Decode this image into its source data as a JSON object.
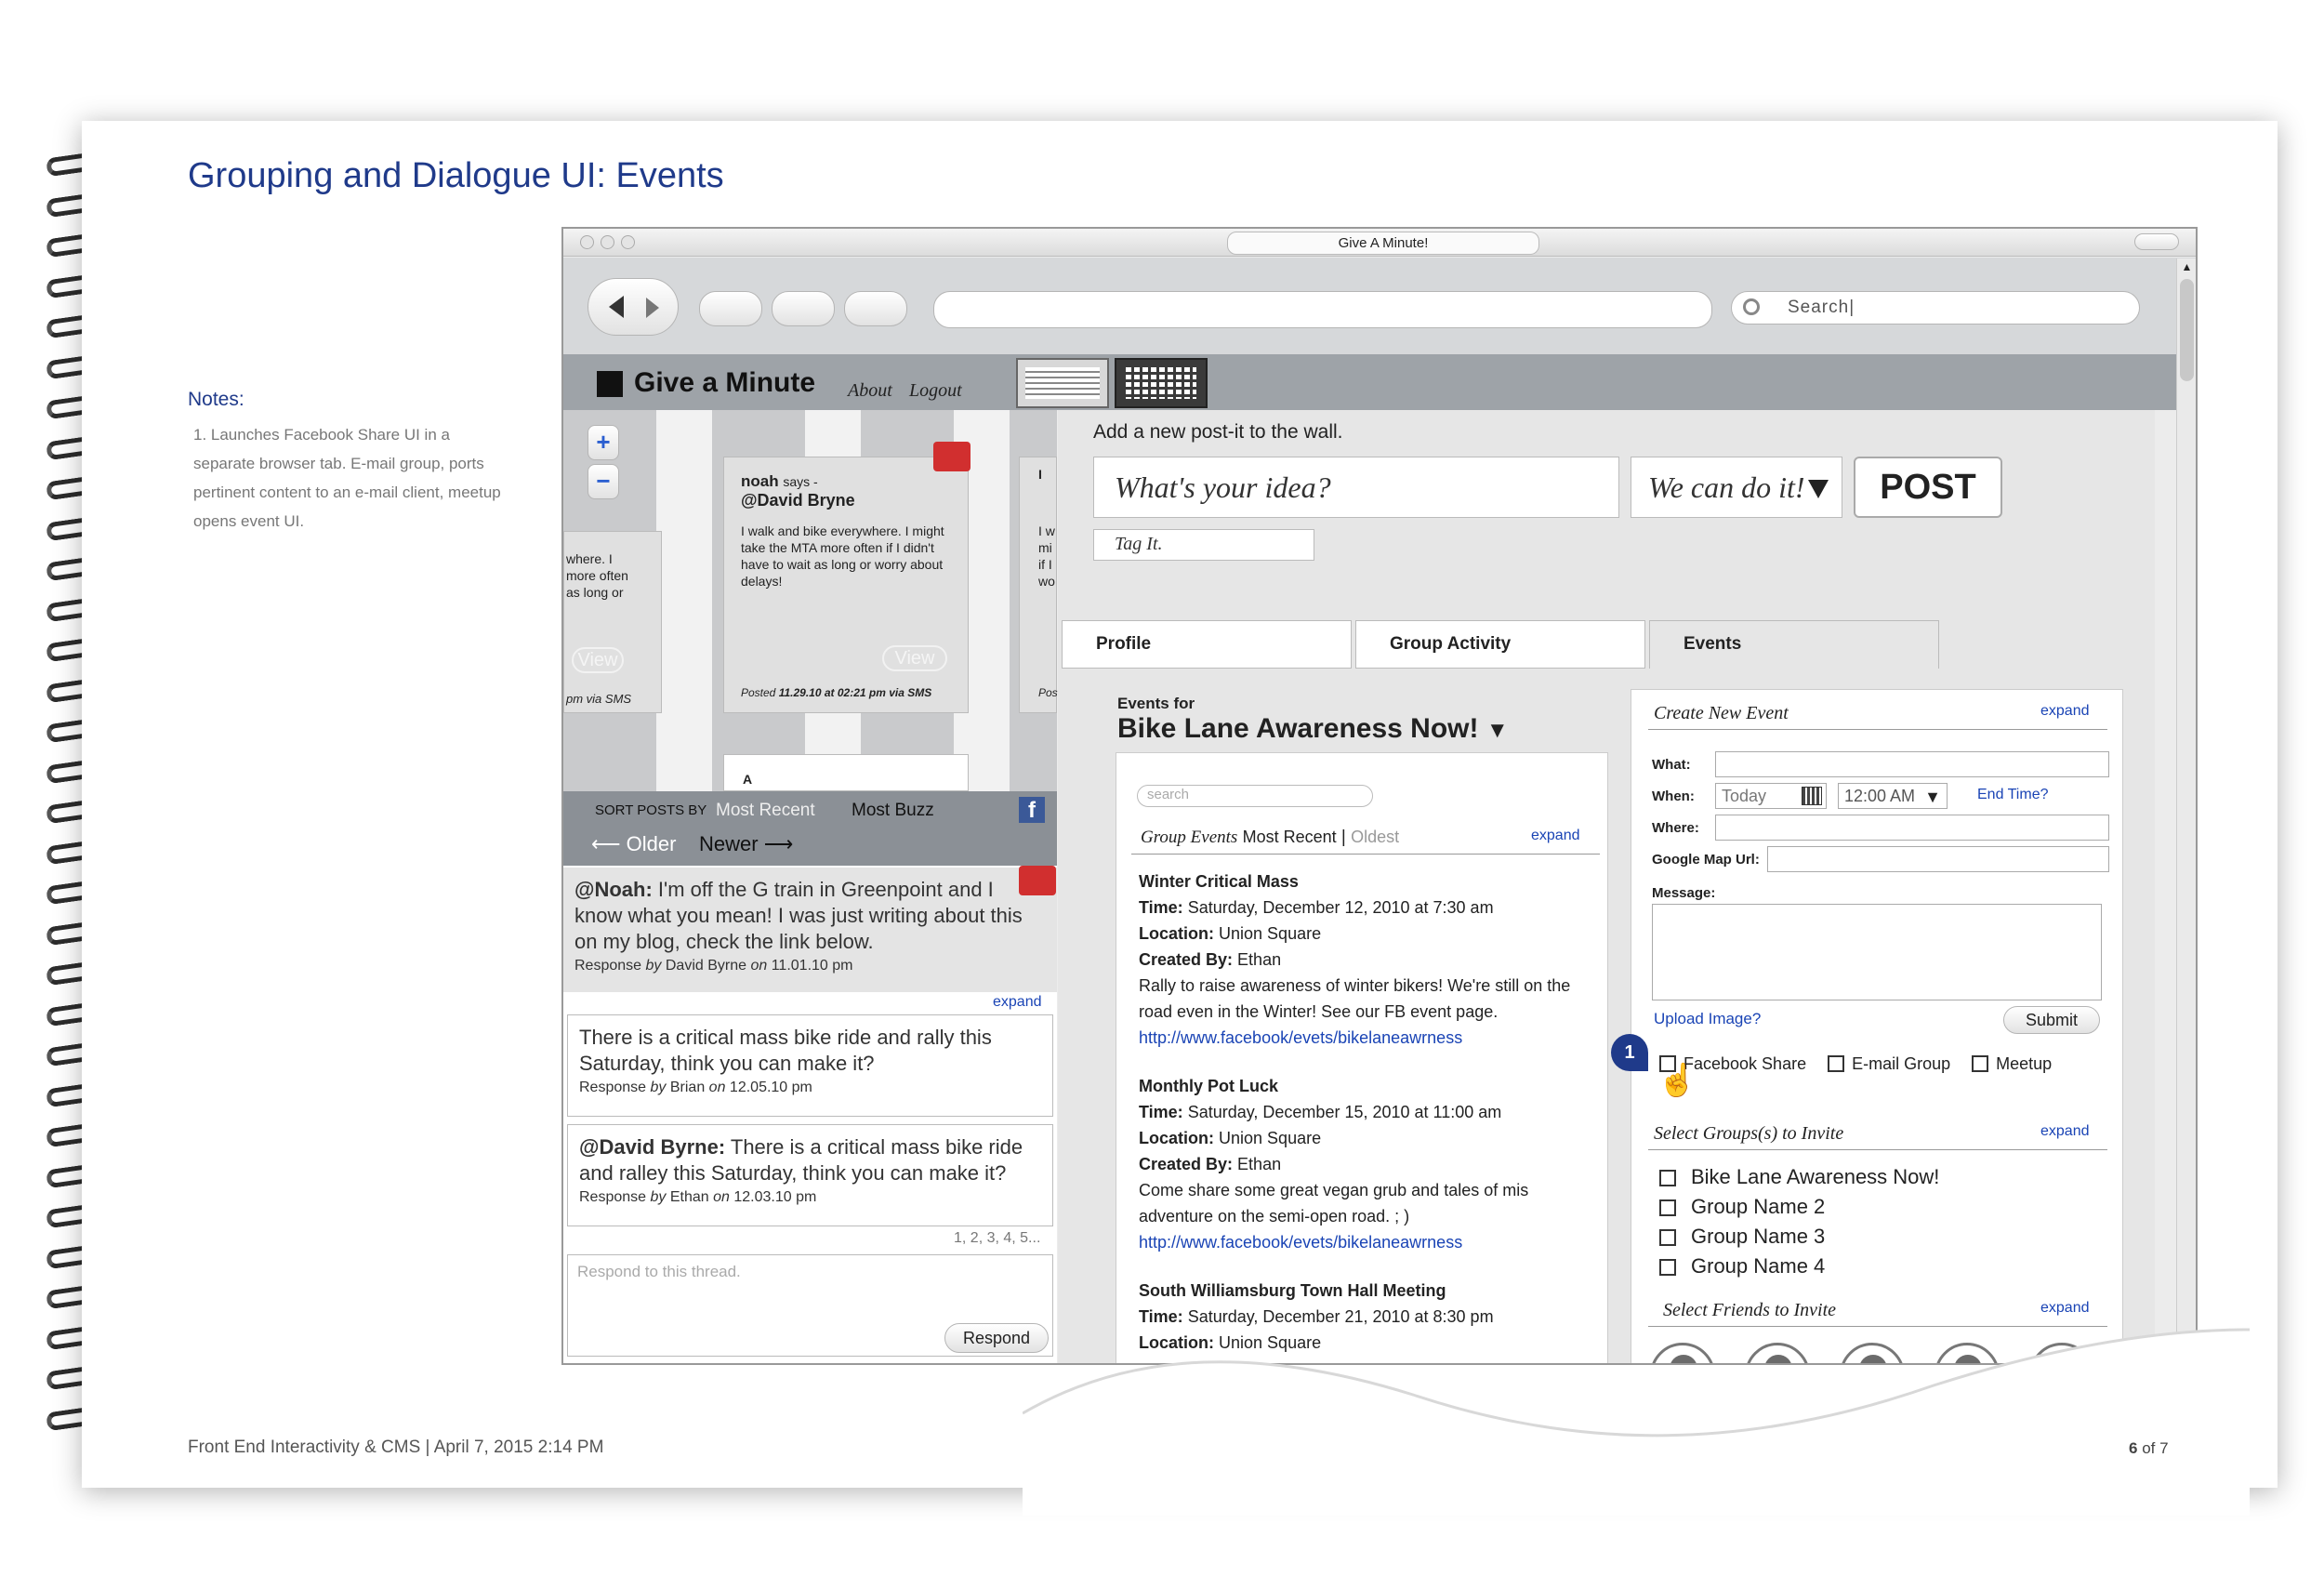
{
  "page": {
    "title": "Grouping and Dialogue UI: Events",
    "notes_heading": "Notes:",
    "notes": [
      "1.    Launches Facebook Share UI in a separate browser tab. E-mail group, ports pertinent content to an e-mail client, meetup opens event UI."
    ],
    "footer_left": "Front End Interactivity & CMS  | April 7, 2015 2:14 PM",
    "footer_page": "6",
    "footer_of": "of 7"
  },
  "browser": {
    "window_title": "Give A Minute!",
    "search_placeholder": "Search|"
  },
  "app": {
    "logo": "Give a Minute",
    "nav_about": "About",
    "nav_logout": "Logout",
    "post_prompt": "Add a new post-it to the wall.",
    "idea_placeholder": "What's your idea?",
    "cando_label": "We can do it!",
    "post_button": "POST",
    "tag_placeholder": "Tag It.",
    "tabs": [
      "Profile",
      "Group Activity",
      "Events"
    ]
  },
  "wall": {
    "card_main": {
      "author": "noah",
      "says": "says -",
      "to": "@David Bryne",
      "text": "I walk and bike everywhere. I might take the MTA more often if I didn't have to wait as long or worry about delays!",
      "posted_label": "Posted",
      "posted": "11.29.10 at 02:21 pm via",
      "via": "SMS",
      "view": "View"
    },
    "card_left": {
      "text": "where. I\nmore often\nas long or",
      "via": "pm via SMS",
      "view": "View"
    },
    "card_right_fragment": "I w\nmi\nif I\nwo",
    "card_right_posted": "Pos",
    "card_bottom": "A"
  },
  "sortbar": {
    "label": "SORT POSTS BY",
    "most_recent": "Most Recent",
    "most_buzz": "Most Buzz",
    "older": "Older",
    "newer": "Newer"
  },
  "thread": {
    "items": [
      {
        "mention": "@Noah:",
        "text": " I'm off the G train in Greenpoint and I know what you mean! I was just writing about this on my blog, check the link below.",
        "meta_prefix": "Response",
        "meta_by": "by",
        "author": "David Byrne",
        "meta_on": "on",
        "date": "11.01.10 pm"
      },
      {
        "mention": "",
        "text": "There is a critical mass bike ride and rally this Saturday, think you can make it?",
        "meta_prefix": "Response",
        "meta_by": "by",
        "author": "Brian",
        "meta_on": "on",
        "date": "12.05.10 pm"
      },
      {
        "mention": "@David Byrne:",
        "text": " There is a critical mass bike ride and ralley this Saturday, think you can make it?",
        "meta_prefix": "Response",
        "meta_by": "by",
        "author": "Ethan",
        "meta_on": "on",
        "date": "12.03.10 pm"
      }
    ],
    "expand": "expand",
    "pagination": "1, 2, 3, 4, 5...",
    "respond_placeholder": "Respond to this thread.",
    "respond_button": "Respond"
  },
  "events": {
    "for_label": "Events for",
    "group_name": "Bike Lane Awareness Now!",
    "search_placeholder": "search",
    "list_header": "Group Events",
    "sort_recent": "Most Recent",
    "sort_oldest": "Oldest",
    "expand": "expand",
    "labels": {
      "time": "Time:",
      "location": "Location:",
      "created_by": "Created By:"
    },
    "items": [
      {
        "title": "Winter Critical Mass",
        "time": "Saturday, December 12, 2010 at 7:30 am",
        "location": "Union Square",
        "created_by": "Ethan",
        "description": "Rally to raise awareness of winter bikers! We're still on the road even in the Winter! See our FB event page.",
        "link": "http://www.facebook/evets/bikelaneawrness"
      },
      {
        "title": "Monthly Pot Luck",
        "time": "Saturday, December 15, 2010 at 11:00 am",
        "location": "Union Square",
        "created_by": "Ethan",
        "description": "Come share some great vegan grub and tales of mis adventure on the semi-open road. ; )",
        "link": "http://www.facebook/evets/bikelaneawrness"
      },
      {
        "title": "South Williamsburg Town Hall Meeting",
        "time": "Saturday, December 21, 2010 at 8:30 pm",
        "location": "Union Square"
      }
    ]
  },
  "create_event": {
    "title": "Create New Event",
    "expand": "expand",
    "what_label": "What:",
    "when_label": "When:",
    "when_date": "Today",
    "when_time": "12:00 AM",
    "end_time": "End Time?",
    "where_label": "Where:",
    "map_label": "Google Map Url:",
    "message_label": "Message:",
    "upload": "Upload Image?",
    "submit": "Submit",
    "callout": "1",
    "share_options": [
      "Facebook Share",
      "E-mail Group",
      "Meetup"
    ],
    "groups_title": "Select Groups(s) to Invite",
    "groups": [
      "Bike Lane Awareness Now!",
      "Group Name 2",
      "Group Name 3",
      "Group Name 4"
    ],
    "friends_title": "Select Friends to Invite"
  },
  "colors": {
    "accent": "#1f3a8a",
    "link": "#1a44b5",
    "alert": "#d12f2f",
    "callout": "#1f3a8a"
  }
}
